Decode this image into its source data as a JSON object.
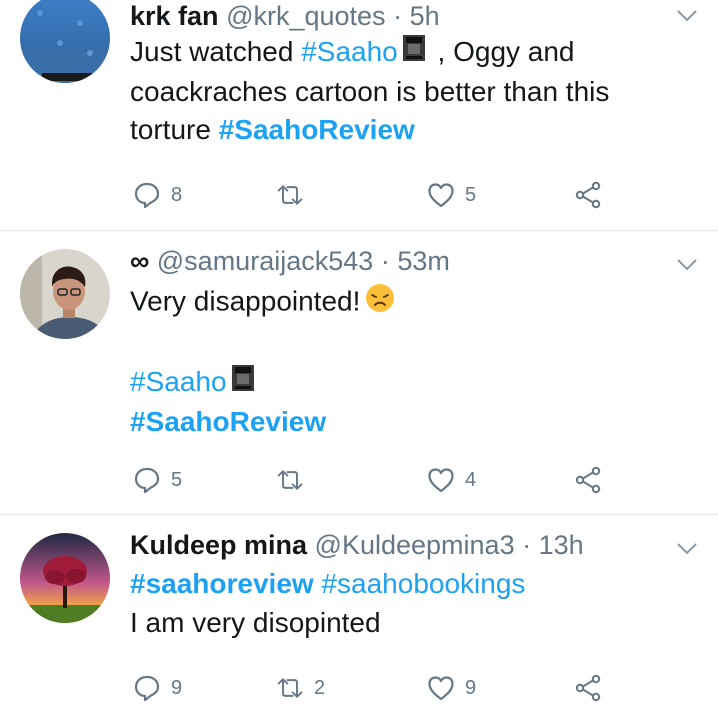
{
  "tweets": [
    {
      "name": "krk fan",
      "handle": "@krk_quotes",
      "separator": "·",
      "time": "5h",
      "line1_text": "Just watched ",
      "line1_tag": "#Saaho",
      "line1_rest": " , Oggy and",
      "line2": "coackraches cartoon is better than this",
      "line3_text": "torture ",
      "line3_tag": "#SaahoReview",
      "replies": "8",
      "retweets": "",
      "likes": "5"
    },
    {
      "name_symbol": "∞",
      "handle": "@samuraijack543",
      "separator": "·",
      "time": "53m",
      "line1": "Very disappointed!",
      "tag1": "#Saaho",
      "tag2": "#SaahoReview",
      "replies": "5",
      "retweets": "",
      "likes": "4"
    },
    {
      "name": "Kuldeep mina",
      "handle": "@Kuldeepmina3",
      "separator": "·",
      "time": "13h",
      "tag1": "#saahoreview",
      "tag2": "#saahobookings",
      "line2": "I am very disopinted",
      "replies": "9",
      "retweets": "2",
      "likes": "9"
    }
  ],
  "icons": {
    "reply": "reply-icon",
    "retweet": "retweet-icon",
    "like": "heart-icon",
    "share": "share-icon",
    "menu": "chevron-down-icon"
  },
  "colors": {
    "link": "#1da1f2",
    "muted": "#657786",
    "text": "#14171a",
    "divider": "#e1e8ed"
  }
}
